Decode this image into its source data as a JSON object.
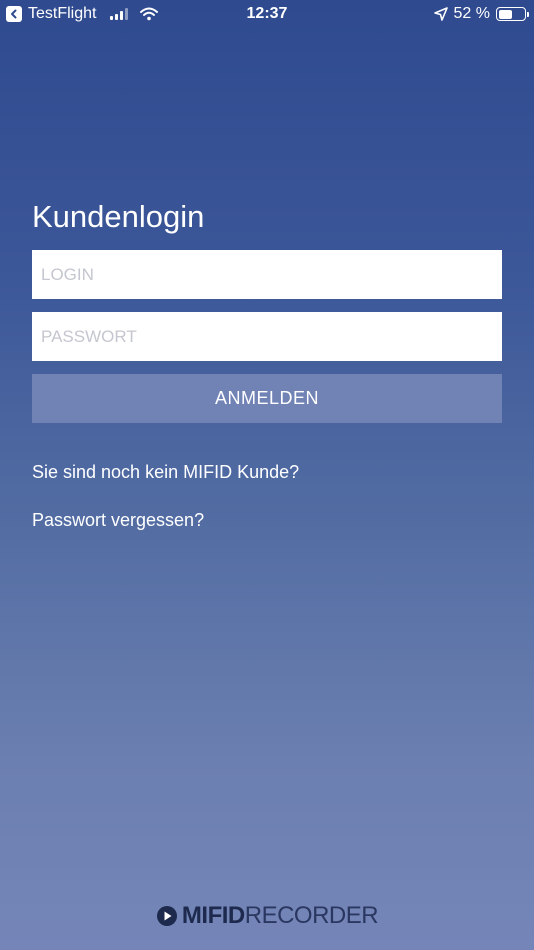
{
  "status_bar": {
    "app_name": "TestFlight",
    "time": "12:37",
    "battery_text": "52 %",
    "battery_level": 0.52
  },
  "login": {
    "title": "Kundenlogin",
    "login_placeholder": "LOGIN",
    "password_placeholder": "PASSWORT",
    "submit_label": "ANMELDEN",
    "register_link": "Sie sind noch kein MIFID Kunde?",
    "forgot_link": "Passwort vergessen?"
  },
  "footer": {
    "logo_part1": "MIFID",
    "logo_part2": "RECORDER"
  },
  "colors": {
    "button_bg": "#7182b5",
    "gradient_top": "#2f4a8f",
    "gradient_bottom": "#7585b8",
    "logo_text": "#1d2a4d"
  }
}
